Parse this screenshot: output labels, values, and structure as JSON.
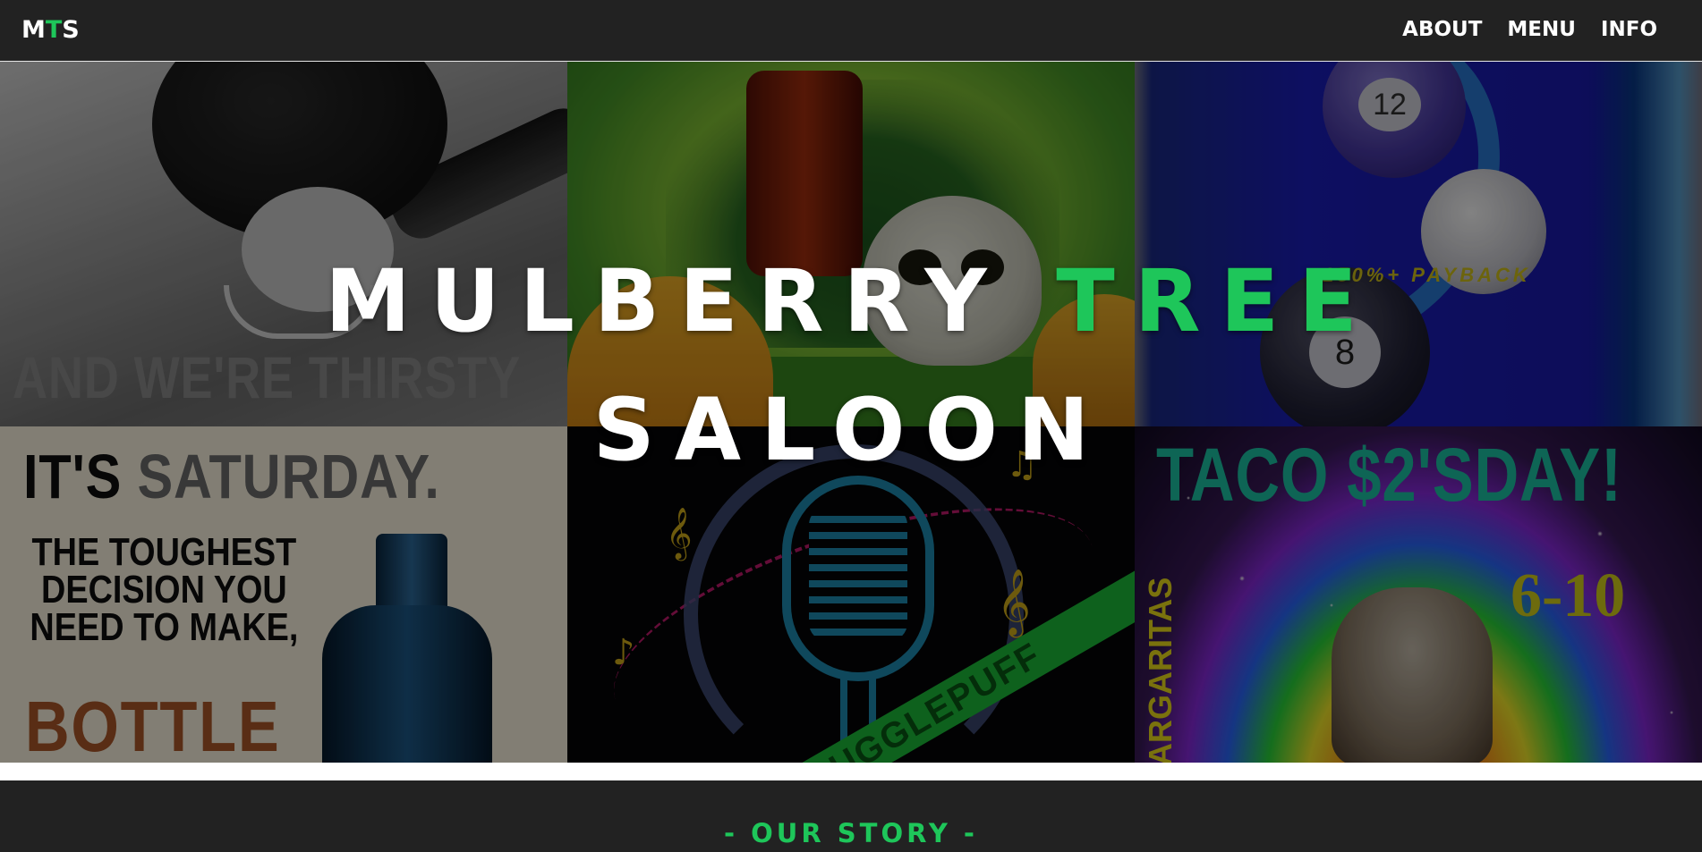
{
  "colors": {
    "nav_bg": "#222222",
    "accent_green": "#1ec65a",
    "text_white": "#ffffff"
  },
  "navbar": {
    "brand": {
      "part1": "M",
      "part2": "T",
      "part3": "S"
    },
    "links": [
      {
        "label": "ABOUT"
      },
      {
        "label": "MENU"
      },
      {
        "label": "INFO"
      }
    ]
  },
  "hero": {
    "title": {
      "word1": "MULBERRY",
      "word2": "TREE",
      "word3": "SALOON"
    },
    "tiles": [
      {
        "name": "vintage-drinking-photo",
        "text": "AND WE'RE THIRSTY"
      },
      {
        "name": "skull-taco-poster",
        "text": ""
      },
      {
        "name": "pool-night-poster",
        "text": "150%+ PAYBACK",
        "ball_numbers": [
          "12",
          "8"
        ]
      },
      {
        "name": "saturday-bottle-poster",
        "line1_dark": "IT'S ",
        "line1_mid": "SATURDAY.",
        "line2": "THE TOUGHEST DECISION YOU NEED TO MAKE,",
        "line3": "BOTTLE"
      },
      {
        "name": "karaoke-mic-poster",
        "band_text": "UGGLEPUFF"
      },
      {
        "name": "taco-tuesday-poster",
        "title": "TACO $2'SDAY!",
        "time": "6-10",
        "side": "ARGARITAS"
      }
    ]
  },
  "story": {
    "heading": "- OUR STORY -"
  }
}
